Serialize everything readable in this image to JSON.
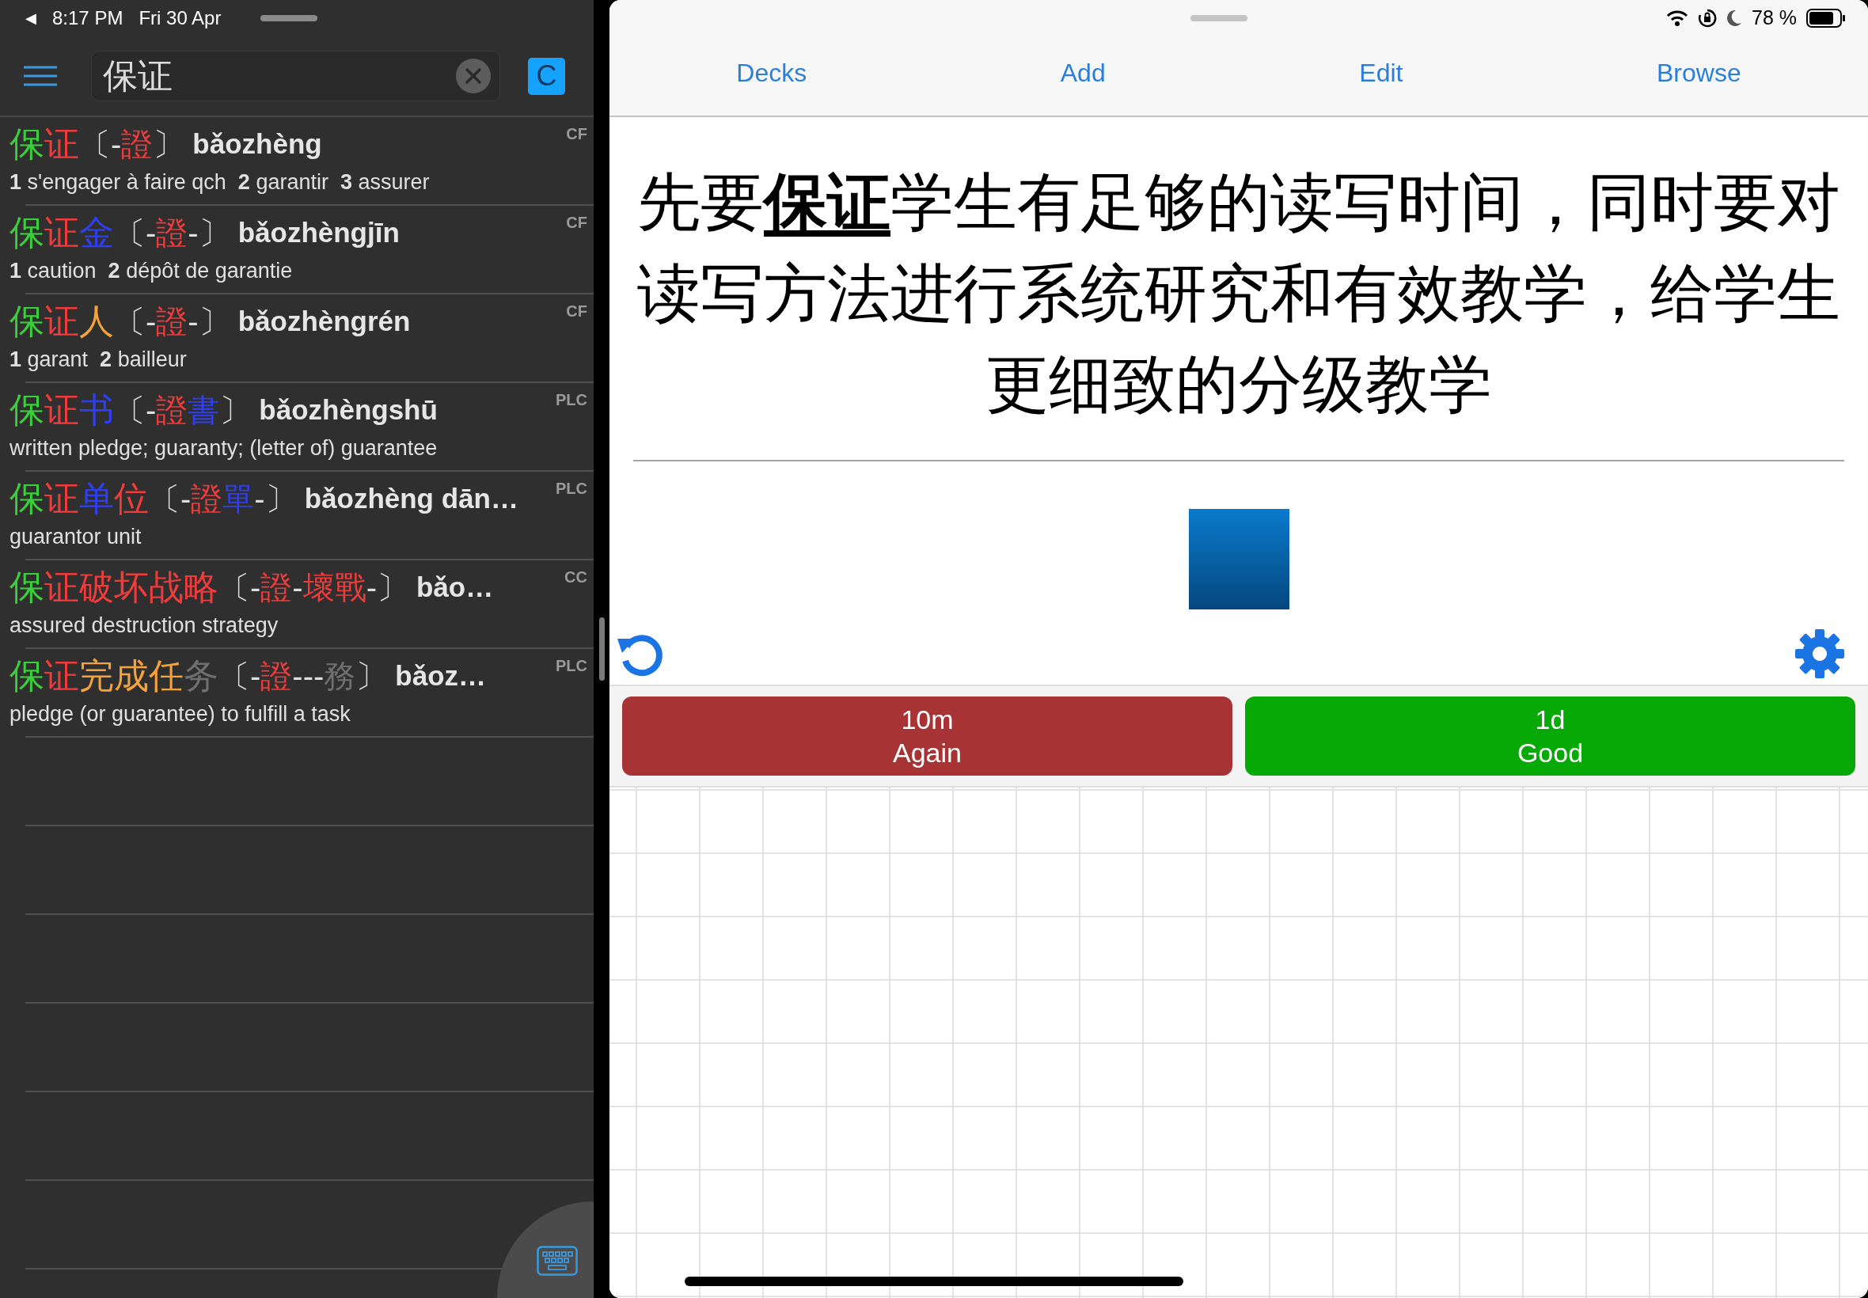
{
  "left_status_bar": {
    "back": "◀",
    "time": "8:17 PM",
    "date": "Fri 30 Apr"
  },
  "search": {
    "value": "保证",
    "mode_button": "C"
  },
  "results": [
    {
      "headword": [
        {
          "text": "保",
          "color": "#3ccf3c"
        },
        {
          "text": "证",
          "color": "#f03b3b"
        }
      ],
      "traditional": [
        {
          "text": "〔-",
          "color": "#dddddd"
        },
        {
          "text": "證",
          "color": "#f03b3b"
        },
        {
          "text": "〕",
          "color": "#dddddd"
        }
      ],
      "pinyin": "bǎozhèng",
      "definition": "**1** s'engager à faire qch  **2** garantir  **3** assurer",
      "source": "CF"
    },
    {
      "headword": [
        {
          "text": "保",
          "color": "#3ccf3c"
        },
        {
          "text": "证",
          "color": "#f03b3b"
        },
        {
          "text": "金",
          "color": "#2e3ff2"
        }
      ],
      "traditional": [
        {
          "text": "〔-",
          "color": "#dddddd"
        },
        {
          "text": "證",
          "color": "#f03b3b"
        },
        {
          "text": "-〕",
          "color": "#dddddd"
        }
      ],
      "pinyin": "bǎozhèngjīn",
      "definition": "**1** caution  **2** dépôt de garantie",
      "source": "CF"
    },
    {
      "headword": [
        {
          "text": "保",
          "color": "#3ccf3c"
        },
        {
          "text": "证",
          "color": "#f03b3b"
        },
        {
          "text": "人",
          "color": "#f5a13c"
        }
      ],
      "traditional": [
        {
          "text": "〔-",
          "color": "#dddddd"
        },
        {
          "text": "證",
          "color": "#f03b3b"
        },
        {
          "text": "-〕",
          "color": "#dddddd"
        }
      ],
      "pinyin": "bǎozhèngrén",
      "definition": "**1** garant  **2** bailleur",
      "source": "CF"
    },
    {
      "headword": [
        {
          "text": "保",
          "color": "#3ccf3c"
        },
        {
          "text": "证",
          "color": "#f03b3b"
        },
        {
          "text": "书",
          "color": "#2e3ff2"
        }
      ],
      "traditional": [
        {
          "text": "〔-",
          "color": "#dddddd"
        },
        {
          "text": "證",
          "color": "#f03b3b"
        },
        {
          "text": "書",
          "color": "#2e3ff2"
        },
        {
          "text": "〕",
          "color": "#dddddd"
        }
      ],
      "pinyin": "bǎozhèngshū",
      "definition": "written pledge; guaranty; (letter of) guarantee",
      "source": "PLC"
    },
    {
      "headword": [
        {
          "text": "保",
          "color": "#3ccf3c"
        },
        {
          "text": "证",
          "color": "#f03b3b"
        },
        {
          "text": "单",
          "color": "#2e3ff2"
        },
        {
          "text": "位",
          "color": "#f03b3b"
        }
      ],
      "traditional": [
        {
          "text": "〔-",
          "color": "#dddddd"
        },
        {
          "text": "證",
          "color": "#f03b3b"
        },
        {
          "text": "單",
          "color": "#2e3ff2"
        },
        {
          "text": "-〕",
          "color": "#dddddd"
        }
      ],
      "pinyin": "bǎozhèng dān…",
      "definition": "guarantor unit",
      "source": "PLC"
    },
    {
      "headword": [
        {
          "text": "保",
          "color": "#3ccf3c"
        },
        {
          "text": "证破坏战略",
          "color": "#f03b3b"
        }
      ],
      "traditional": [
        {
          "text": "〔-",
          "color": "#dddddd"
        },
        {
          "text": "證",
          "color": "#f03b3b"
        },
        {
          "text": "-",
          "color": "#dddddd"
        },
        {
          "text": "壞戰",
          "color": "#f03b3b"
        },
        {
          "text": "-〕",
          "color": "#dddddd"
        }
      ],
      "pinyin": "bǎo…",
      "definition": "assured destruction strategy",
      "source": "CC"
    },
    {
      "headword": [
        {
          "text": "保",
          "color": "#3ccf3c"
        },
        {
          "text": "证",
          "color": "#f03b3b"
        },
        {
          "text": "完成任",
          "color": "#f5a13c"
        },
        {
          "text": "务",
          "color": "#6f6f6f"
        }
      ],
      "traditional": [
        {
          "text": "〔-",
          "color": "#dddddd"
        },
        {
          "text": "證",
          "color": "#f03b3b"
        },
        {
          "text": "---",
          "color": "#dddddd"
        },
        {
          "text": "務",
          "color": "#6f6f6f"
        },
        {
          "text": "〕",
          "color": "#dddddd"
        }
      ],
      "pinyin": "bǎoz…",
      "definition": "pledge (or guarantee) to fulfill a task",
      "source": "PLC"
    }
  ],
  "right_status_bar": {
    "battery_text": "78 %"
  },
  "toolbar_buttons": [
    "Decks",
    "Add",
    "Edit",
    "Browse"
  ],
  "card": {
    "text": "先要**保证**学生有足够的读写时间，同时要对读写方法进行系统研究和有效教学，给学生更细致的分级教学"
  },
  "answer_buttons": [
    {
      "kind": "again",
      "interval": "10m",
      "label": "Again"
    },
    {
      "kind": "good",
      "interval": "1d",
      "label": "Good"
    }
  ]
}
